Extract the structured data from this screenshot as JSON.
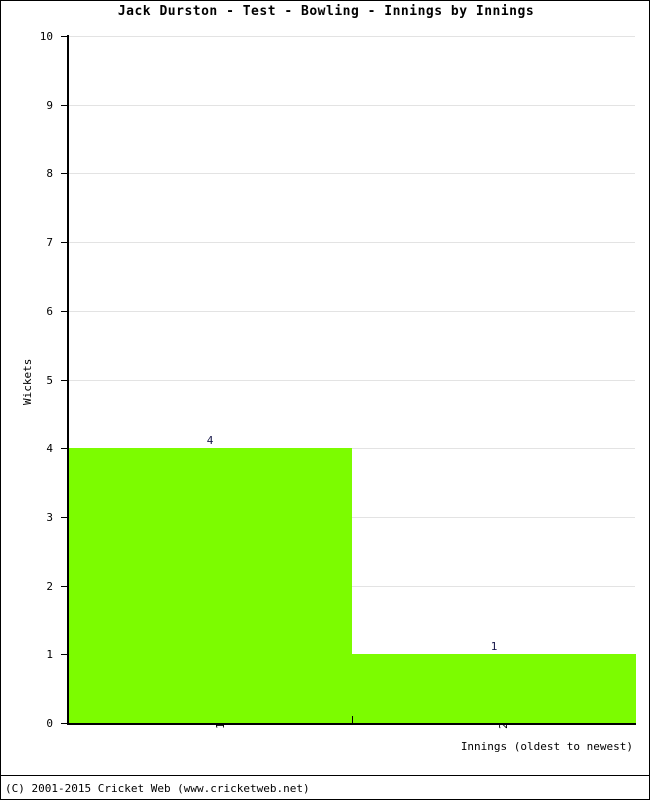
{
  "chart_data": {
    "type": "bar",
    "title": "Jack Durston - Test - Bowling - Innings by Innings",
    "xlabel": "Innings (oldest to newest)",
    "ylabel": "Wickets",
    "categories": [
      "1",
      "2"
    ],
    "values": [
      4,
      1
    ],
    "data_labels": [
      "4",
      "1"
    ],
    "ylim": [
      0,
      10
    ],
    "ytick_labels": [
      "0",
      "1",
      "2",
      "3",
      "4",
      "5",
      "6",
      "7",
      "8",
      "9",
      "10"
    ],
    "ytick_values": [
      0,
      1,
      2,
      3,
      4,
      5,
      6,
      7,
      8,
      9,
      10
    ],
    "grid": true,
    "legend": "none",
    "bar_color": "#7CFC00",
    "grid_color": "#e3e3e3",
    "axis_color": "#000000",
    "label_color": "#17174a"
  },
  "footer": {
    "copyright": "(C) 2001-2015 Cricket Web (www.cricketweb.net)"
  }
}
